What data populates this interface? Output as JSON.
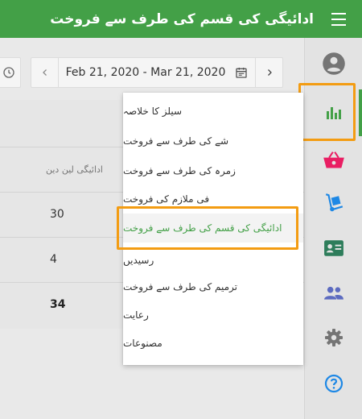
{
  "header": {
    "title": "ادائیگی کی قسم کی طرف سے فروخت"
  },
  "datebar": {
    "range": "Feb 21, 2020 - Mar 21, 2020"
  },
  "report": {
    "column_header": "ادائیگی لین دین",
    "rows": [
      "30",
      "4"
    ],
    "total": "34"
  },
  "reports_menu": {
    "items": [
      "سیلز کا خلاصہ",
      "شے کی طرف سے فروخت",
      "زمرہ کی طرف سے فروخت",
      "فی ملازم کی فروخت",
      "ادائیگی کی قسم کی طرف سے فروخت",
      "رسیدیں",
      "ترمیم کی طرف سے فروخت",
      "رعایت",
      "مصنوعات"
    ],
    "active_index": 4
  },
  "colors": {
    "brand_green": "#43a047",
    "highlight_orange": "#f39c12",
    "basket_pink": "#e91e63",
    "icon_blue": "#1e88e5",
    "people_purple": "#5c6bc0",
    "gear_gray": "#757575"
  },
  "icons": {
    "menu": "hamburger-icon",
    "account": "account-circle-icon",
    "reports": "bar-chart-icon",
    "sales": "basket-icon",
    "inventory": "hand-truck-icon",
    "employees": "badge-icon",
    "customers": "people-icon",
    "settings": "gear-icon",
    "help": "help-icon",
    "calendar": "calendar-icon",
    "clock": "clock-icon"
  }
}
